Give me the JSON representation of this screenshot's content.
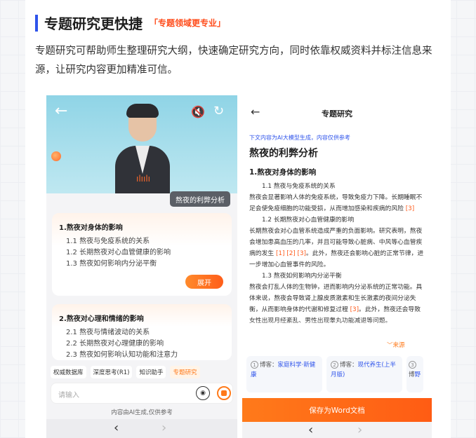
{
  "section": {
    "title": "专题研究更快捷",
    "tag": "「专题领域更专业」",
    "intro": "专题研究可帮助师生整理研究大纲，快速确定研究方向，同时依靠权威资料并标注信息来源，让研究内容更加精准可信。"
  },
  "left_phone": {
    "topic_pill": "熬夜的利弊分析",
    "outline1": {
      "heading": "1.熬夜对身体的影响",
      "items": [
        "1.1 熬夜与免疫系统的关系",
        "1.2 长期熬夜对心血管健康的影响",
        "1.3 熬夜如何影响内分泌平衡"
      ],
      "expand_label": "展开"
    },
    "outline2": {
      "heading": "2.熬夜对心理和情绪的影响",
      "items": [
        "2.1 熬夜与情绪波动的关系",
        "2.2 长期熬夜对心理健康的影响",
        "2.3 熬夜如何影响认知功能和注意力"
      ]
    },
    "tools": [
      "权威数据库",
      "深度思考(R1)",
      "知识助手",
      "专题研究"
    ],
    "input_placeholder": "请输入",
    "ai_note": "内容由AI生成,仅供参考"
  },
  "right_phone": {
    "title": "专题研究",
    "disclaimer": "下文内容为AI大模型生成，内容仅供参考",
    "h1": "熬夜的利弊分析",
    "h2": "1.熬夜对身体的影响",
    "body": {
      "s1": "1.1 熬夜与免疫系统的关系",
      "p1a": "熬夜会显著影响人体的免疫系统，导致免疫力下降。长期睡眠不足会使免疫细胞的功能受损，从而增加感染和疾病的风险",
      "p1_cite": "[3]",
      "s2": "1.2 长期熬夜对心血管健康的影响",
      "p2a": "长期熬夜会对心血管系统造成严重的负面影响。研究表明，熬夜会增加患高血压的几率，并且可能导致心脏病、中风等心血管疾病的发生",
      "p2_cite": "[1] [2] [3]",
      "p2b": "。此外，熬夜还会影响心脏的正常节律，进一步增加心血管事件的风险。",
      "s3": "1.3 熬夜如何影响内分泌平衡",
      "p3a": "熬夜会打乱人体的生物钟，进而影响内分泌系统的正常功能。具体来说，熬夜会导致肾上腺皮质激素和生长激素的夜间分泌失衡，从而影响身体的代谢和修复过程",
      "p3_cite": "[3]",
      "p3b": "。此外，熬夜还会导致女性出现月经紊乱、男性出现睾丸功能减退等问题。"
    },
    "sources_toggle": "来源",
    "sources": [
      {
        "num": "1",
        "prefix": "博客：",
        "text": "家庭科学·新健康"
      },
      {
        "num": "2",
        "prefix": "博客：",
        "text": "现代养生(上半月版)"
      },
      {
        "num": "3",
        "prefix": "博",
        "text": "野"
      }
    ],
    "save_label": "保存为Word文档"
  },
  "colors": {
    "accent": "#ff6a1a",
    "blue": "#2f54eb"
  }
}
